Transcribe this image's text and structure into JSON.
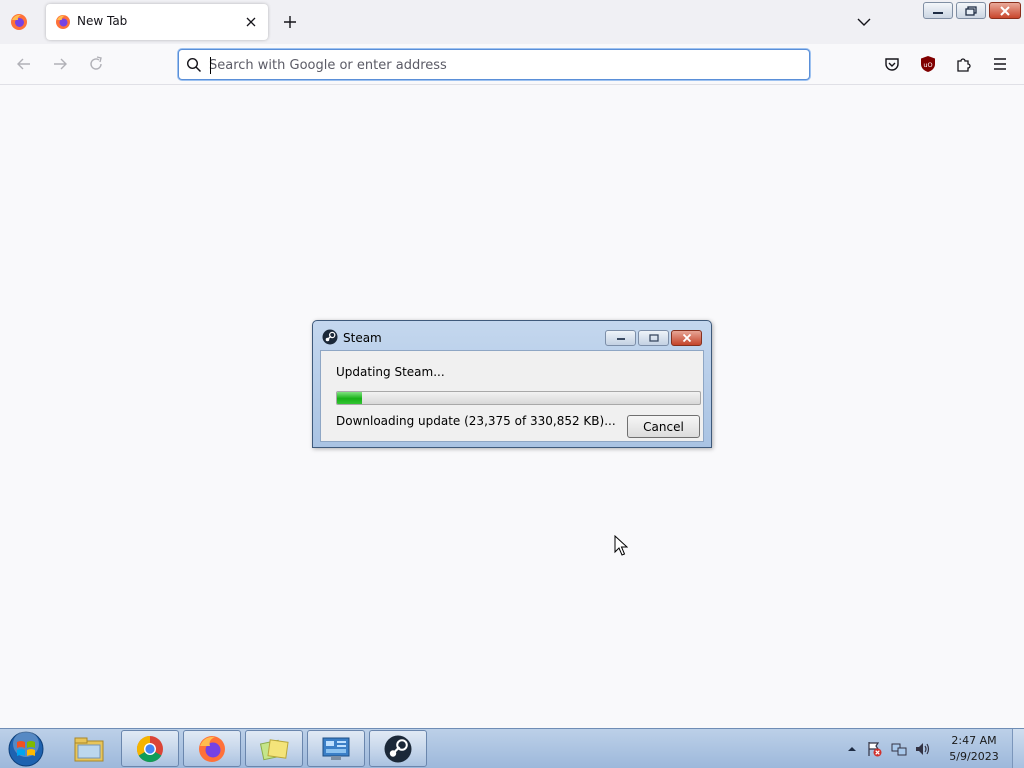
{
  "browser": {
    "tab": {
      "title": "New Tab"
    },
    "urlbar": {
      "placeholder": "Search with Google or enter address",
      "value": ""
    }
  },
  "dialog": {
    "title": "Steam",
    "status": "Updating Steam...",
    "progress": 0.07,
    "detail": "Downloading update (23,375 of 330,852 KB)...",
    "cancel_label": "Cancel"
  },
  "taskbar": {
    "items": [
      "windows-explorer-icon",
      "chrome-icon",
      "firefox-icon",
      "sticky-notes-icon",
      "control-panel-icon",
      "steam-icon"
    ],
    "tray_icons": [
      "show-hidden-icons-icon",
      "action-center-icon",
      "network-icon",
      "volume-icon"
    ],
    "clock": {
      "time": "2:47 AM",
      "date": "5/9/2023"
    }
  },
  "colors": {
    "progress_green": "#17b117",
    "accent_blue": "#5a8fd8"
  }
}
